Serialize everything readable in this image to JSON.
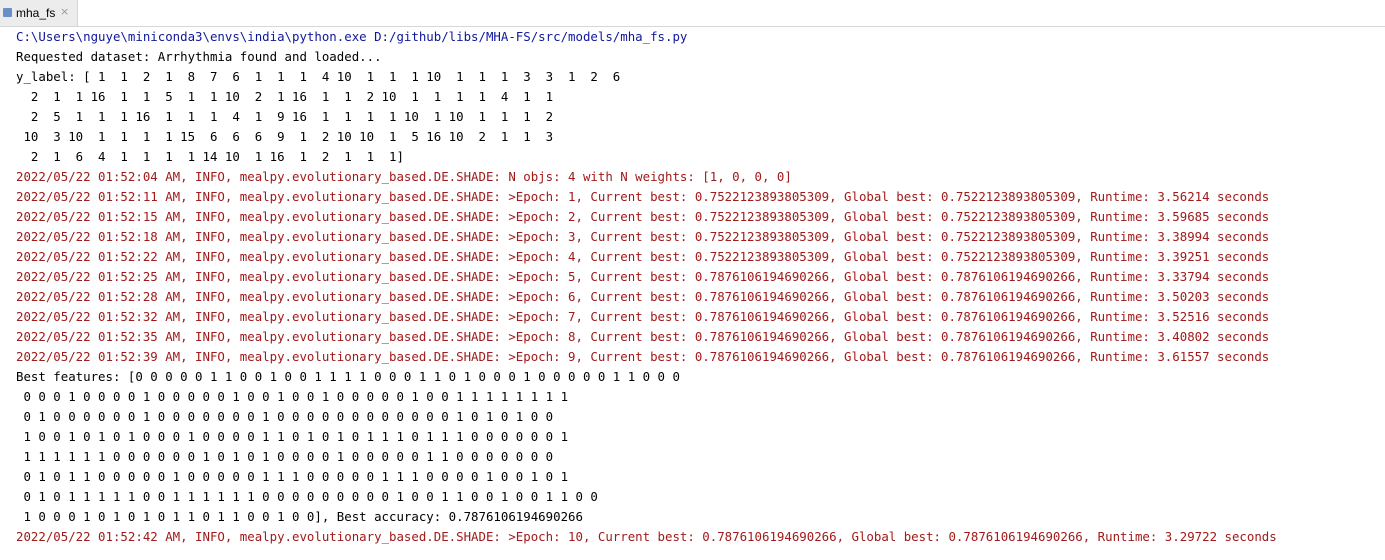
{
  "tab": {
    "label": "mha_fs",
    "close_glyph": "×",
    "icon": "python-file-icon"
  },
  "colors": {
    "command": "#10189a",
    "log": "#a11a1a",
    "stdout": "#000000",
    "tab_bg": "#ececec"
  },
  "console": {
    "command_line": "C:\\Users\\nguye\\miniconda3\\envs\\india\\python.exe D:/github/libs/MHA-FS/src/models/mha_fs.py",
    "dataset_line": "Requested dataset: Arrhythmia found and loaded...",
    "y_label_lines": [
      "y_label: [ 1  1  2  1  8  7  6  1  1  1  4 10  1  1  1 10  1  1  1  3  3  1  2  6",
      "  2  1  1 16  1  1  5  1  1 10  2  1 16  1  1  2 10  1  1  1  1  4  1  1",
      "  2  5  1  1  1 16  1  1  1  4  1  9 16  1  1  1  1 10  1 10  1  1  1  2",
      " 10  3 10  1  1  1  1 15  6  6  6  9  1  2 10 10  1  5 16 10  2  1  1  3",
      "  2  1  6  4  1  1  1  1 14 10  1 16  1  2  1  1  1]"
    ],
    "log_lines": [
      "2022/05/22 01:52:04 AM, INFO, mealpy.evolutionary_based.DE.SHADE: N objs: 4 with N weights: [1, 0, 0, 0]",
      "2022/05/22 01:52:11 AM, INFO, mealpy.evolutionary_based.DE.SHADE: >Epoch: 1, Current best: 0.7522123893805309, Global best: 0.7522123893805309, Runtime: 3.56214 seconds",
      "2022/05/22 01:52:15 AM, INFO, mealpy.evolutionary_based.DE.SHADE: >Epoch: 2, Current best: 0.7522123893805309, Global best: 0.7522123893805309, Runtime: 3.59685 seconds",
      "2022/05/22 01:52:18 AM, INFO, mealpy.evolutionary_based.DE.SHADE: >Epoch: 3, Current best: 0.7522123893805309, Global best: 0.7522123893805309, Runtime: 3.38994 seconds",
      "2022/05/22 01:52:22 AM, INFO, mealpy.evolutionary_based.DE.SHADE: >Epoch: 4, Current best: 0.7522123893805309, Global best: 0.7522123893805309, Runtime: 3.39251 seconds",
      "2022/05/22 01:52:25 AM, INFO, mealpy.evolutionary_based.DE.SHADE: >Epoch: 5, Current best: 0.7876106194690266, Global best: 0.7876106194690266, Runtime: 3.33794 seconds",
      "2022/05/22 01:52:28 AM, INFO, mealpy.evolutionary_based.DE.SHADE: >Epoch: 6, Current best: 0.7876106194690266, Global best: 0.7876106194690266, Runtime: 3.50203 seconds",
      "2022/05/22 01:52:32 AM, INFO, mealpy.evolutionary_based.DE.SHADE: >Epoch: 7, Current best: 0.7876106194690266, Global best: 0.7876106194690266, Runtime: 3.52516 seconds",
      "2022/05/22 01:52:35 AM, INFO, mealpy.evolutionary_based.DE.SHADE: >Epoch: 8, Current best: 0.7876106194690266, Global best: 0.7876106194690266, Runtime: 3.40802 seconds",
      "2022/05/22 01:52:39 AM, INFO, mealpy.evolutionary_based.DE.SHADE: >Epoch: 9, Current best: 0.7876106194690266, Global best: 0.7876106194690266, Runtime: 3.61557 seconds"
    ],
    "best_features_lines": [
      "Best features: [0 0 0 0 0 1 1 0 0 1 0 0 1 1 1 1 0 0 0 1 1 0 1 0 0 0 1 0 0 0 0 0 1 1 0 0 0",
      " 0 0 0 1 0 0 0 0 1 0 0 0 0 0 1 0 0 1 0 0 1 0 0 0 0 0 1 0 0 1 1 1 1 1 1 1 1",
      " 0 1 0 0 0 0 0 0 1 0 0 0 0 0 0 0 1 0 0 0 0 0 0 0 0 0 0 0 0 1 0 1 0 1 0 0",
      " 1 0 0 1 0 1 0 1 0 0 0 1 0 0 0 0 1 1 0 1 0 1 0 1 1 1 0 1 1 1 0 0 0 0 0 0 1",
      " 1 1 1 1 1 1 0 0 0 0 0 0 1 0 1 0 1 0 0 0 0 1 0 0 0 0 0 1 1 0 0 0 0 0 0 0",
      " 0 1 0 1 1 0 0 0 0 0 1 0 0 0 0 0 1 1 1 0 0 0 0 0 1 1 1 0 0 0 0 1 0 0 1 0 1",
      " 0 1 0 1 1 1 1 1 0 0 1 1 1 1 1 1 0 0 0 0 0 0 0 0 0 1 0 0 1 1 0 0 1 0 0 1 1 0 0",
      " 1 0 0 0 1 0 1 0 1 0 1 1 0 1 1 0 0 1 0 0], Best accuracy: 0.7876106194690266"
    ],
    "final_log_line": "2022/05/22 01:52:42 AM, INFO, mealpy.evolutionary_based.DE.SHADE: >Epoch: 10, Current best: 0.7876106194690266, Global best: 0.7876106194690266, Runtime: 3.29722 seconds"
  }
}
